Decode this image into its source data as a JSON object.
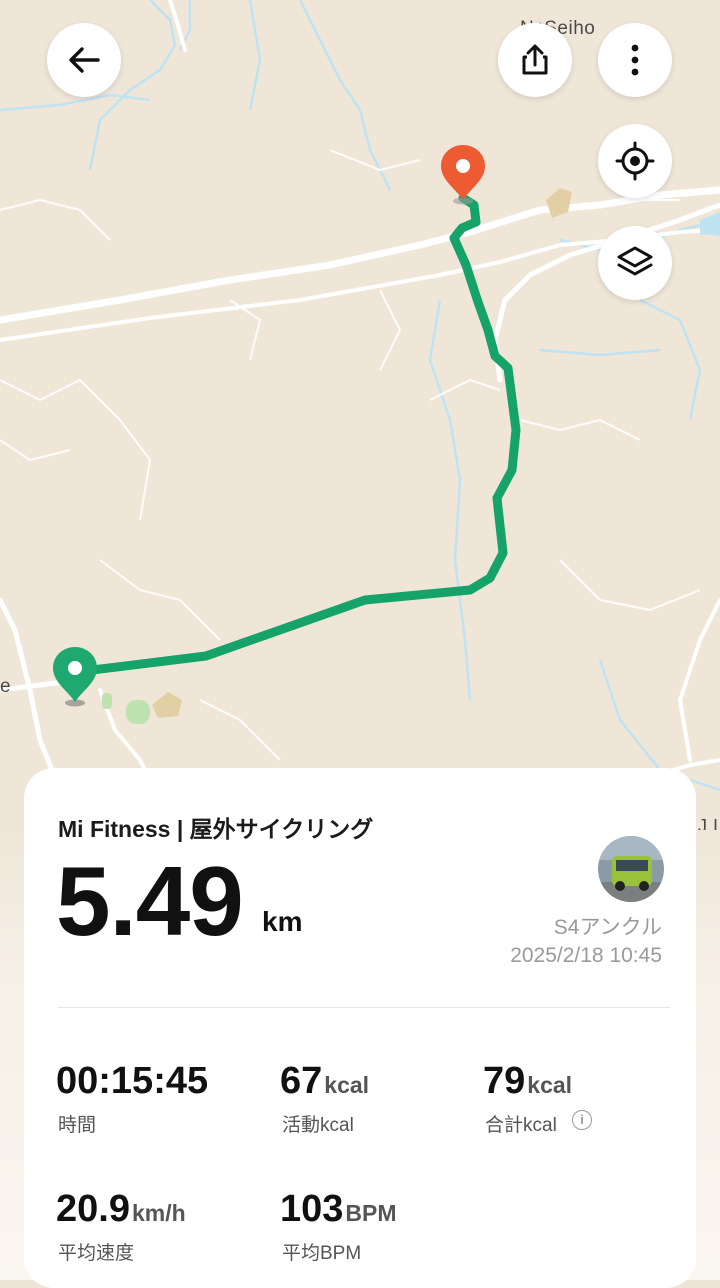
{
  "map": {
    "place_label": "Seiho",
    "place_label_partial": "N",
    "edge_label_left": "e",
    "edge_label_right": "J I"
  },
  "toolbar": {
    "back_icon": "arrow-left-icon",
    "share_icon": "share-icon",
    "more_icon": "more-vertical-icon",
    "locate_icon": "crosshair-icon",
    "layers_icon": "layers-icon"
  },
  "activity": {
    "title": "Mi Fitness | 屋外サイクリング",
    "distance": "5.49",
    "distance_unit": "km",
    "device": "S4アンクル",
    "datetime": "2025/2/18 10:45"
  },
  "stats": [
    {
      "value": "00:15:45",
      "unit": "",
      "label": "時間"
    },
    {
      "value": "67",
      "unit": "kcal",
      "label": "活動kcal"
    },
    {
      "value": "79",
      "unit": "kcal",
      "label": "合計kcal",
      "info": "i"
    },
    {
      "value": "20.9",
      "unit": "km/h",
      "label": "平均速度"
    },
    {
      "value": "103",
      "unit": "BPM",
      "label": "平均BPM"
    }
  ],
  "colors": {
    "route": "#16a36a",
    "start_marker": "#1fa86f",
    "end_marker": "#ee5a32",
    "map_background": "#efe6d8",
    "road": "#ffffff",
    "river": "#bfe3f3"
  }
}
